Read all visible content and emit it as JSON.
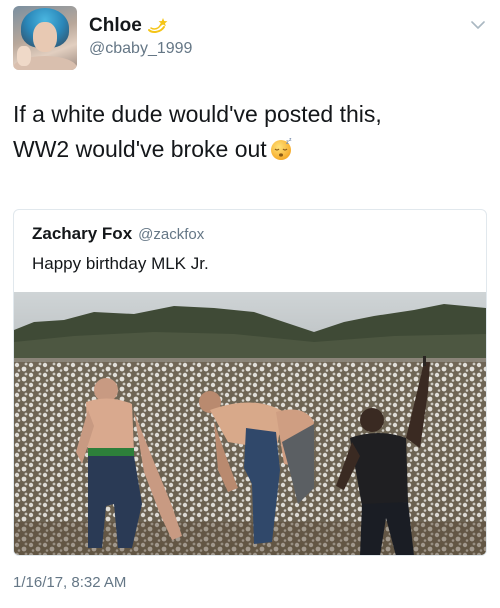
{
  "author": {
    "display_name": "Chloe",
    "handle": "@cbaby_1999"
  },
  "tweet": {
    "text_line1": "If a white dude would've posted this,",
    "text_line2": "WW2 would've broke out",
    "timestamp": "1/16/17, 8:32 AM"
  },
  "quoted_tweet": {
    "display_name": "Zachary Fox",
    "handle": "@zackfox",
    "text": "Happy birthday MLK Jr."
  },
  "icons": {
    "name_emoji": "dizzy-emoji-icon",
    "text_emoji": "sleeping-face-emoji-icon",
    "menu": "chevron-down-icon"
  },
  "colors": {
    "text": "#14171a",
    "secondary_text": "#657786",
    "border": "#e1e8ed"
  }
}
